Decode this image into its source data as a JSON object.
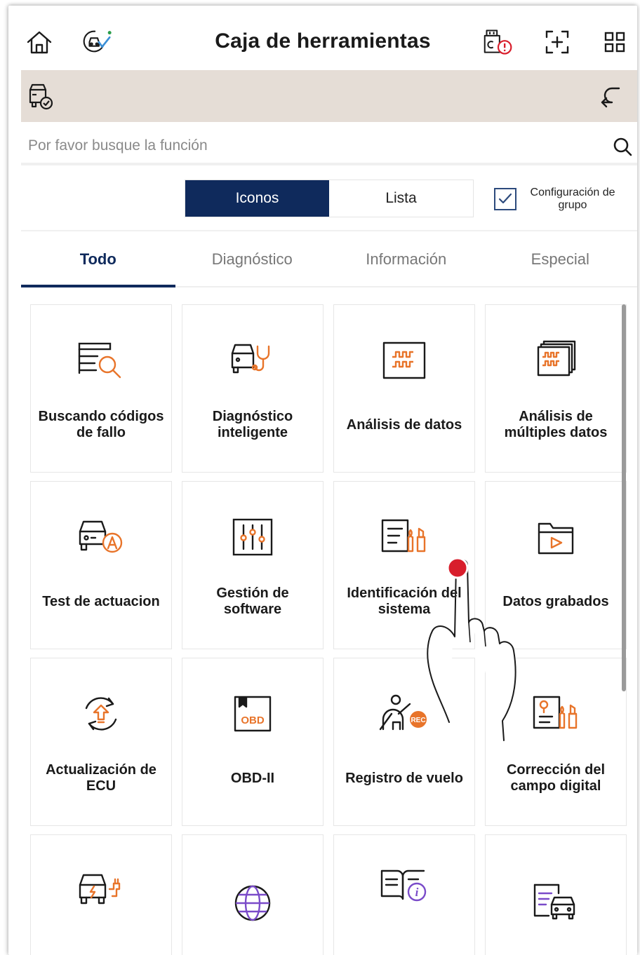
{
  "header": {
    "title": "Caja de herramientas",
    "icons": [
      "home-icon",
      "vehicle-diagnostic-icon",
      "usb-warning-icon",
      "screenshot-icon",
      "apps-grid-icon"
    ]
  },
  "vehicle_bar": {
    "icons": [
      "vehicle-check-icon",
      "return-icon"
    ],
    "background": "#e5ddd6"
  },
  "search": {
    "placeholder": "Por favor busque la función"
  },
  "view_toggle": {
    "options": [
      "Iconos",
      "Lista"
    ],
    "selected": "Iconos"
  },
  "group_config": {
    "label": "Configuración de grupo",
    "checked": true
  },
  "tabs": [
    {
      "label": "Todo",
      "active": true
    },
    {
      "label": "Diagnóstico",
      "active": false
    },
    {
      "label": "Información",
      "active": false
    },
    {
      "label": "Especial",
      "active": false
    }
  ],
  "tiles": [
    {
      "label": "Buscando códigos de fallo",
      "icon": "fault-code-search-icon"
    },
    {
      "label": "Diagnóstico inteligente",
      "icon": "smart-diagnosis-icon"
    },
    {
      "label": "Análisis de datos",
      "icon": "data-analysis-icon"
    },
    {
      "label": "Análisis de múltiples datos",
      "icon": "multi-data-analysis-icon"
    },
    {
      "label": "Test de actuacion",
      "icon": "actuation-test-icon"
    },
    {
      "label": "Gestión de software",
      "icon": "software-management-icon"
    },
    {
      "label": "Identificación del sistema",
      "icon": "system-identification-icon"
    },
    {
      "label": "Datos grabados",
      "icon": "recorded-data-icon"
    },
    {
      "label": "Actualización de ECU",
      "icon": "ecu-update-icon"
    },
    {
      "label": "OBD-II",
      "icon": "obd-ii-icon"
    },
    {
      "label": "Registro de vuelo",
      "icon": "flight-recorder-icon"
    },
    {
      "label": "Corrección del campo digital",
      "icon": "digital-field-correction-icon"
    },
    {
      "label": "",
      "icon": "ev-charging-icon"
    },
    {
      "label": "",
      "icon": "globe-icon"
    },
    {
      "label": "",
      "icon": "manual-info-icon"
    },
    {
      "label": "",
      "icon": "vehicle-document-icon"
    }
  ],
  "icon_badges": {
    "obd_text": "OBD",
    "rec_text": "REC"
  },
  "colors": {
    "accent": "#0f2a5c",
    "orange": "#e8742a",
    "tap_indicator": "#d81e2c",
    "ok_green": "#2a9d4a",
    "check_blue": "#3b8fd6",
    "purple": "#7a4bc9"
  }
}
